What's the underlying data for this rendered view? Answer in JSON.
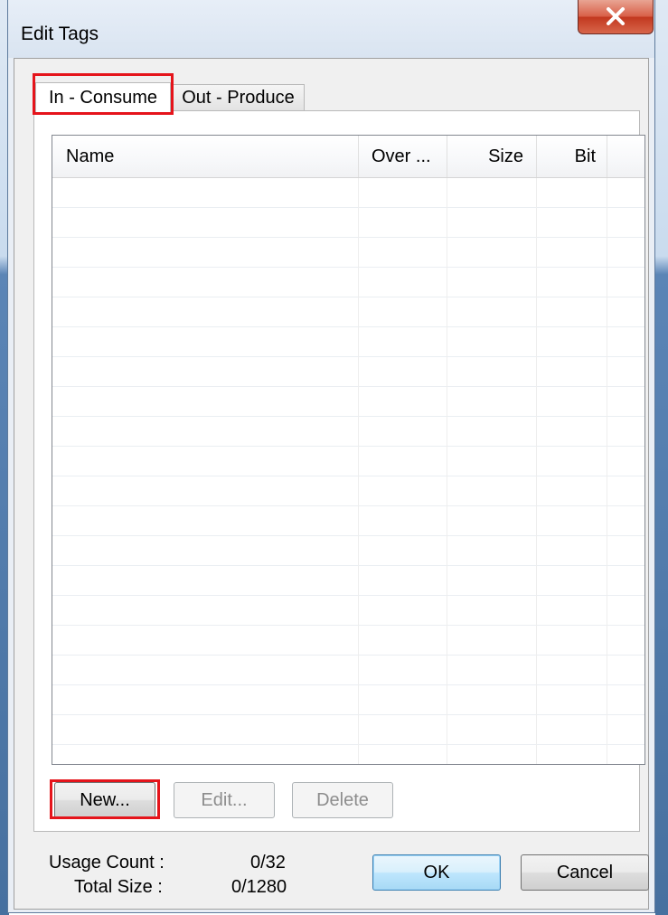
{
  "window": {
    "title": "Edit Tags"
  },
  "tabs": [
    {
      "label": "In - Consume",
      "active": true
    },
    {
      "label": "Out - Produce",
      "active": false
    }
  ],
  "table": {
    "columns": [
      "Name",
      "Over ...",
      "Size",
      "Bit"
    ],
    "rows": []
  },
  "list_buttons": {
    "new": "New...",
    "edit": "Edit...",
    "delete": "Delete"
  },
  "stats": {
    "usage_count_label": "Usage Count :",
    "usage_count_value": "0/32",
    "total_size_label": "Total Size :",
    "total_size_value": "0/1280"
  },
  "dialog_buttons": {
    "ok": "OK",
    "cancel": "Cancel"
  },
  "icons": {
    "close": "close-icon"
  },
  "colors": {
    "highlight": "#e5141b",
    "close_button": "#c2381f"
  }
}
